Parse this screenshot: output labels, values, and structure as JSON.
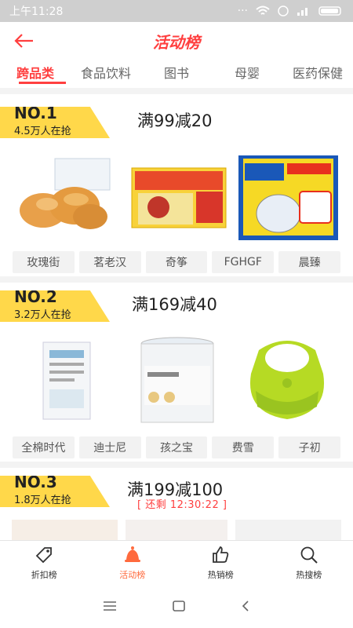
{
  "status": {
    "time": "上午11:28"
  },
  "header": {
    "title": "活动榜",
    "back_icon": "back-arrow-icon"
  },
  "tabs": [
    "跨品类",
    "食品饮料",
    "图书",
    "母婴",
    "医药保健"
  ],
  "sections": [
    {
      "rank": "NO.1",
      "people": "4.5万人在抢",
      "promo": "满99减20",
      "brands": [
        "玫瑰街",
        "茗老汉",
        "奇筝",
        "FGHGF",
        "晨臻"
      ]
    },
    {
      "rank": "NO.2",
      "people": "3.2万人在抢",
      "promo": "满169减40",
      "brands": [
        "全棉时代",
        "迪士尼",
        "孩之宝",
        "费雪",
        "子初"
      ]
    },
    {
      "rank": "NO.3",
      "people": "1.8万人在抢",
      "promo": "满199减100",
      "countdown": "[ 还剩 12:30:22 ]",
      "brands": []
    }
  ],
  "bottom_nav": [
    {
      "label": "折扣榜",
      "icon": "tag-icon"
    },
    {
      "label": "活动榜",
      "icon": "bell-icon"
    },
    {
      "label": "热销榜",
      "icon": "thumbs-up-icon"
    },
    {
      "label": "热搜榜",
      "icon": "search-icon"
    }
  ],
  "colors": {
    "accent": "#ff3f3f",
    "rank_bg": "#ffd84a"
  }
}
